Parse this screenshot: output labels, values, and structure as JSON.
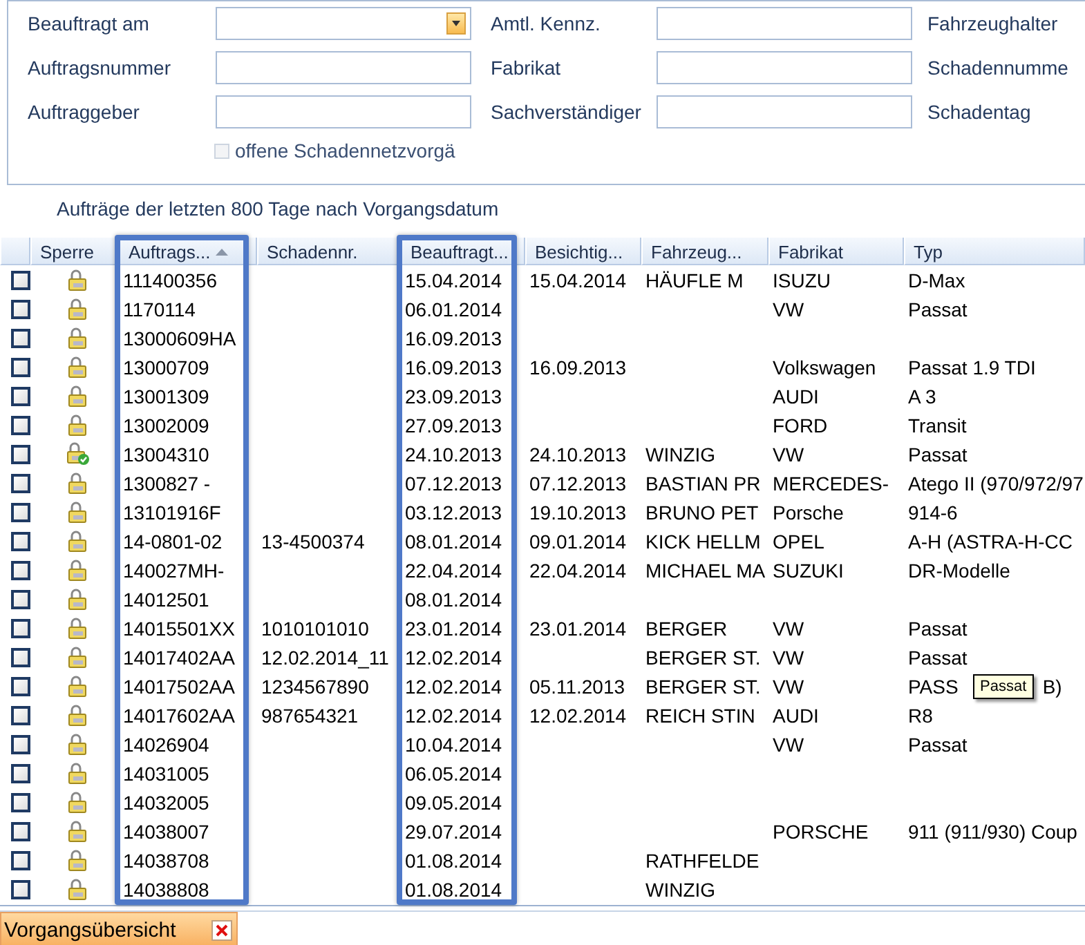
{
  "form": {
    "rows": [
      [
        {
          "label": "Beauftragt am",
          "kind": "dropdown"
        },
        {
          "label": "Amtl. Kennz.",
          "kind": "text"
        },
        {
          "label": "Fahrzeughalter",
          "kind": "label"
        }
      ],
      [
        {
          "label": "Auftragsnummer",
          "kind": "text"
        },
        {
          "label": "Fabrikat",
          "kind": "text"
        },
        {
          "label": "Schadennumme",
          "kind": "label"
        }
      ],
      [
        {
          "label": "Auftraggeber",
          "kind": "text"
        },
        {
          "label": "Sachverständiger",
          "kind": "text"
        },
        {
          "label": "Schadentag",
          "kind": "label"
        }
      ]
    ],
    "checkbox": {
      "label": "offene Schadennetzvorgä",
      "checked": false,
      "disabled": true
    }
  },
  "caption": "Aufträge der letzten 800 Tage nach Vorgangsdatum",
  "columns": [
    {
      "title": "Sperre",
      "sorted": false,
      "highlighted": false
    },
    {
      "title": "Auftrags...",
      "sorted": true,
      "highlighted": true
    },
    {
      "title": "Schadennr.",
      "sorted": false,
      "highlighted": false
    },
    {
      "title": "Beauftragt...",
      "sorted": false,
      "highlighted": true
    },
    {
      "title": "Besichtig...",
      "sorted": false,
      "highlighted": false
    },
    {
      "title": "Fahrzeug...",
      "sorted": false,
      "highlighted": false
    },
    {
      "title": "Fabrikat",
      "sorted": false,
      "highlighted": false
    },
    {
      "title": "Typ",
      "sorted": false,
      "highlighted": false
    }
  ],
  "rows": [
    {
      "checked": false,
      "kind": "locked",
      "auftrag": "111400356",
      "beauftragt": "15.04.2014",
      "besichtigung": "15.04.2014",
      "halter": "HÄUFLE M",
      "fabrikat": "ISUZU",
      "typ": "D-Max"
    },
    {
      "checked": false,
      "kind": "locked",
      "auftrag": "1170114",
      "beauftragt": "06.01.2014",
      "fabrikat": "VW",
      "typ": "Passat"
    },
    {
      "checked": false,
      "kind": "locked",
      "auftrag": "13000609HA",
      "beauftragt": "16.09.2013"
    },
    {
      "checked": false,
      "kind": "locked",
      "auftrag": "13000709",
      "beauftragt": "16.09.2013",
      "besichtigung": "16.09.2013",
      "fabrikat": "Volkswagen",
      "typ": "Passat 1.9 TDI"
    },
    {
      "checked": false,
      "kind": "locked",
      "auftrag": "13001309",
      "beauftragt": "23.09.2013",
      "fabrikat": "AUDI",
      "typ": "A 3"
    },
    {
      "checked": false,
      "kind": "locked",
      "auftrag": "13002009",
      "beauftragt": "27.09.2013",
      "fabrikat": "FORD",
      "typ": "Transit"
    },
    {
      "checked": false,
      "kind": "approved",
      "auftrag": "13004310",
      "beauftragt": "24.10.2013",
      "besichtigung": "24.10.2013",
      "halter": "WINZIG",
      "fabrikat": "VW",
      "typ": "Passat"
    },
    {
      "checked": false,
      "kind": "locked",
      "auftrag": "1300827 -",
      "beauftragt": "07.12.2013",
      "besichtigung": "07.12.2013",
      "halter": "BASTIAN PR",
      "fabrikat": "MERCEDES-",
      "typ": "Atego II (970/972/97"
    },
    {
      "checked": false,
      "kind": "locked",
      "auftrag": "13101916F",
      "beauftragt": "03.12.2013",
      "besichtigung": "19.10.2013",
      "halter": "BRUNO PET",
      "fabrikat": "Porsche",
      "typ": "914-6"
    },
    {
      "checked": false,
      "kind": "locked",
      "auftrag": "14-0801-02",
      "schadennr": "13-4500374",
      "beauftragt": "08.01.2014",
      "besichtigung": "09.01.2014",
      "halter": "KICK HELLM",
      "fabrikat": "OPEL",
      "typ": "A-H (ASTRA-H-CC"
    },
    {
      "checked": false,
      "kind": "locked",
      "auftrag": "140027MH-",
      "beauftragt": "22.04.2014",
      "besichtigung": "22.04.2014",
      "halter": "MICHAEL MA",
      "fabrikat": "SUZUKI",
      "typ": "DR-Modelle"
    },
    {
      "checked": false,
      "kind": "locked",
      "auftrag": "14012501",
      "beauftragt": "08.01.2014"
    },
    {
      "checked": false,
      "kind": "locked",
      "auftrag": "14015501XX",
      "schadennr": "1010101010",
      "beauftragt": "23.01.2014",
      "besichtigung": "23.01.2014",
      "halter": "BERGER",
      "fabrikat": "VW",
      "typ": "Passat"
    },
    {
      "checked": false,
      "kind": "locked",
      "auftrag": "14017402AA",
      "schadennr": "12.02.2014_11",
      "beauftragt": "12.02.2014",
      "halter": "BERGER ST.",
      "fabrikat": "VW",
      "typ": "Passat"
    },
    {
      "checked": false,
      "kind": "locked",
      "auftrag": "14017502AA",
      "schadennr": "1234567890",
      "beauftragt": "12.02.2014",
      "besichtigung": "05.11.2013",
      "halter": "BERGER ST.",
      "fabrikat": "VW",
      "typ": "PASS",
      "typ_tail": "B)",
      "tooltip": "Passat"
    },
    {
      "checked": false,
      "kind": "locked",
      "auftrag": "14017602AA",
      "schadennr": "987654321",
      "beauftragt": "12.02.2014",
      "besichtigung": "12.02.2014",
      "halter": "REICH STIN",
      "fabrikat": "AUDI",
      "typ": "R8"
    },
    {
      "checked": false,
      "kind": "locked",
      "auftrag": "14026904",
      "beauftragt": "10.04.2014",
      "fabrikat": "VW",
      "typ": "Passat"
    },
    {
      "checked": false,
      "kind": "locked",
      "auftrag": "14031005",
      "beauftragt": "06.05.2014"
    },
    {
      "checked": false,
      "kind": "locked",
      "auftrag": "14032005",
      "beauftragt": "09.05.2014"
    },
    {
      "checked": false,
      "kind": "locked",
      "auftrag": "14038007",
      "beauftragt": "29.07.2014",
      "fabrikat": "PORSCHE",
      "typ": "911 (911/930) Coup"
    },
    {
      "checked": false,
      "kind": "locked",
      "auftrag": "14038708",
      "beauftragt": "01.08.2014",
      "halter": "RATHFELDE"
    },
    {
      "checked": false,
      "kind": "locked",
      "auftrag": "14038808",
      "beauftragt": "01.08.2014",
      "halter": "WINZIG"
    }
  ],
  "bottom_tab": {
    "label": "Vorgangsübersicht",
    "selected": true
  }
}
